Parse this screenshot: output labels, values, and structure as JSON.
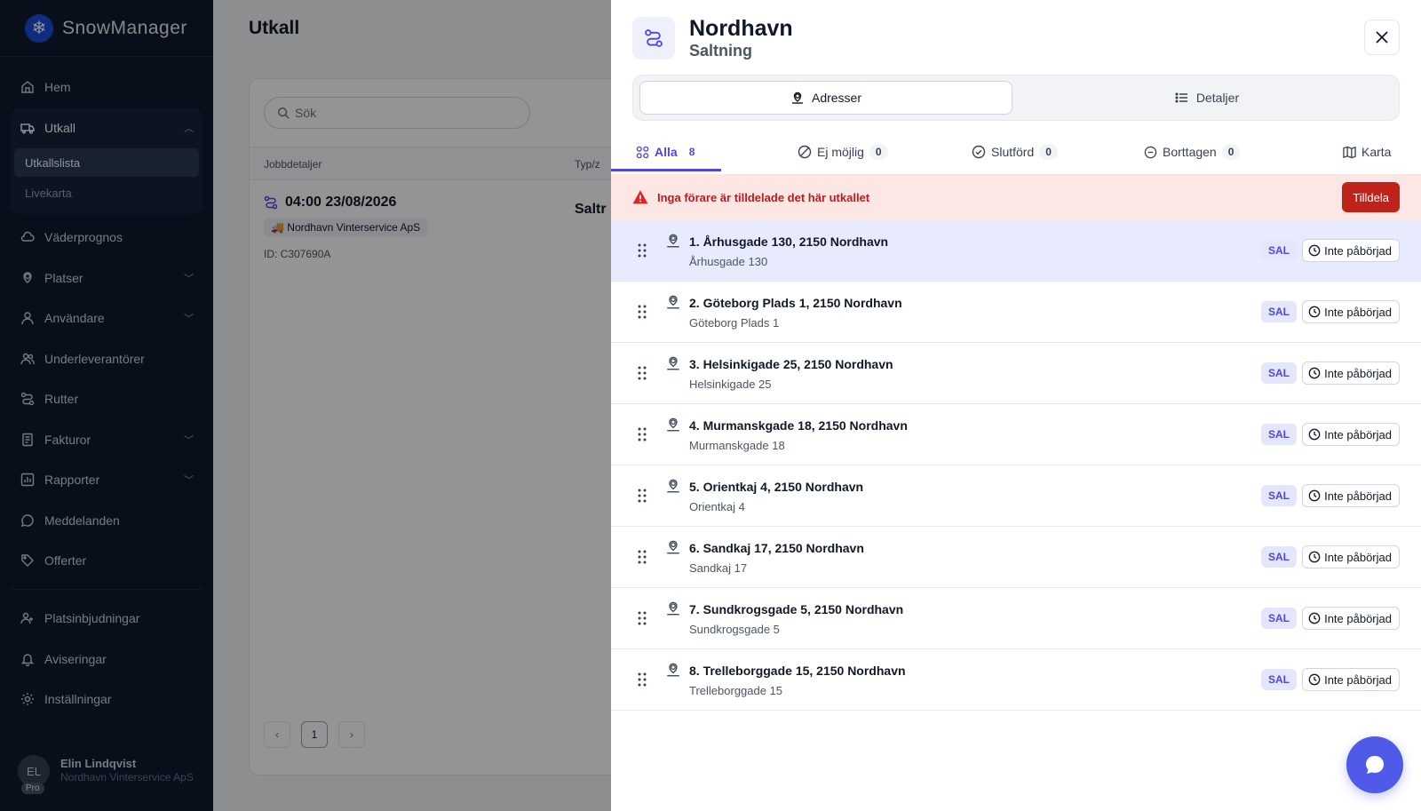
{
  "brand": {
    "name": "SnowManager"
  },
  "sidebar": {
    "items": [
      {
        "label": "Hem"
      },
      {
        "label": "Utkall"
      },
      {
        "label": "Väderprognos"
      },
      {
        "label": "Platser"
      },
      {
        "label": "Användare"
      },
      {
        "label": "Underleverantörer"
      },
      {
        "label": "Rutter"
      },
      {
        "label": "Fakturor"
      },
      {
        "label": "Rapporter"
      },
      {
        "label": "Meddelanden"
      },
      {
        "label": "Offerter"
      },
      {
        "label": "Platsinbjudningar"
      },
      {
        "label": "Aviseringar"
      },
      {
        "label": "Inställningar"
      }
    ],
    "subitems": [
      {
        "label": "Utkallslista"
      },
      {
        "label": "Livekarta"
      }
    ]
  },
  "user": {
    "initials": "EL",
    "badge": "Pro",
    "name": "Elin Lindqvist",
    "org": "Nordhavn Vinterservice ApS"
  },
  "main": {
    "title": "Utkall",
    "search_placeholder": "Sök",
    "col_job": "Jobbdetaljer",
    "col_type": "Typ/z",
    "job": {
      "time": "04:00 23/08/2026",
      "company": "Nordhavn Vinterservice ApS",
      "id": "ID: C307690A",
      "type": "Saltr"
    },
    "page": "1"
  },
  "drawer": {
    "title": "Nordhavn",
    "subtitle": "Saltning",
    "seg_addresses": "Adresser",
    "seg_details": "Detaljer",
    "tabs": [
      {
        "label": "Alla",
        "count": "8"
      },
      {
        "label": "Ej möjlig",
        "count": "0"
      },
      {
        "label": "Slutförd",
        "count": "0"
      },
      {
        "label": "Borttagen",
        "count": "0"
      },
      {
        "label": "Karta"
      }
    ],
    "alert": {
      "text": "Inga förare är tilldelade det här utkallet",
      "button": "Tilldela"
    },
    "rows": [
      {
        "title": "1. Århusgade 130, 2150 Nordhavn",
        "street": "Århusgade 130",
        "badge": "SAL",
        "status": "Inte påbörjad"
      },
      {
        "title": "2. Göteborg Plads 1, 2150 Nordhavn",
        "street": "Göteborg Plads 1",
        "badge": "SAL",
        "status": "Inte påbörjad"
      },
      {
        "title": "3. Helsinkigade 25, 2150 Nordhavn",
        "street": "Helsinkigade 25",
        "badge": "SAL",
        "status": "Inte påbörjad"
      },
      {
        "title": "4. Murmanskgade 18, 2150 Nordhavn",
        "street": "Murmanskgade 18",
        "badge": "SAL",
        "status": "Inte påbörjad"
      },
      {
        "title": "5. Orientkaj 4, 2150 Nordhavn",
        "street": "Orientkaj 4",
        "badge": "SAL",
        "status": "Inte påbörjad"
      },
      {
        "title": "6. Sandkaj 17, 2150 Nordhavn",
        "street": "Sandkaj 17",
        "badge": "SAL",
        "status": "Inte påbörjad"
      },
      {
        "title": "7. Sundkrogsgade 5, 2150 Nordhavn",
        "street": "Sundkrogsgade 5",
        "badge": "SAL",
        "status": "Inte påbörjad"
      },
      {
        "title": "8. Trelleborggade 15, 2150 Nordhavn",
        "street": "Trelleborggade 15",
        "badge": "SAL",
        "status": "Inte påbörjad"
      }
    ]
  },
  "colors": {
    "accent": "#4f46e5",
    "danger": "#c0221a",
    "sidebar": "#0f1b2d"
  }
}
